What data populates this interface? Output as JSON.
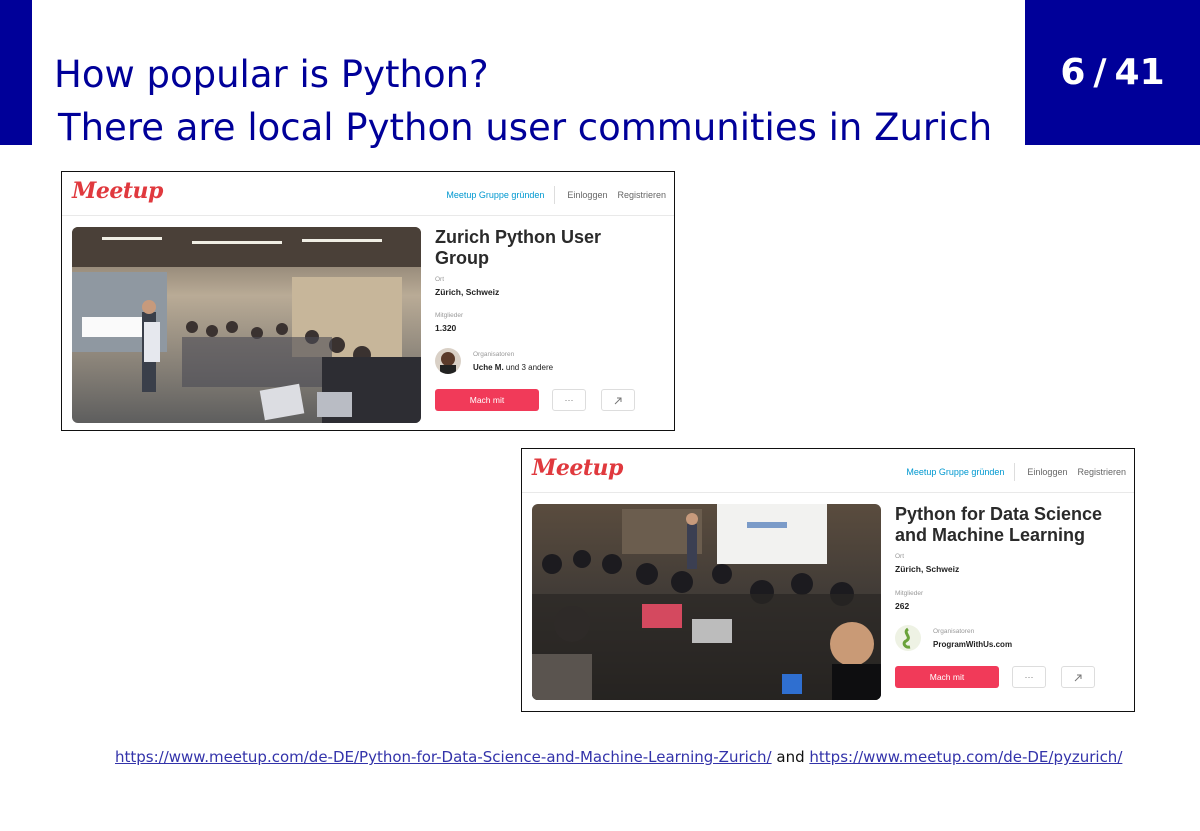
{
  "slide": {
    "title_line1": "How popular is Python?",
    "title_line2": "There are local Python user communities in Zurich",
    "page_current": "6",
    "page_sep": "/",
    "page_total": "41",
    "accent_color": "#000099"
  },
  "cards": [
    {
      "logo": "Meetup",
      "nav_create": "Meetup Gruppe gründen",
      "nav_login": "Einloggen",
      "nav_register": "Registrieren",
      "group_name": "Zurich Python User Group",
      "location_label": "Ort",
      "location": "Zürich, Schweiz",
      "members_label": "Mitglieder",
      "members": "1.320",
      "organizers_label": "Organisatoren",
      "organizer_name": "Uche M.",
      "organizer_suffix": "und 3 andere",
      "join_button": "Mach mit",
      "more_button": "···",
      "share_icon": "share-icon"
    },
    {
      "logo": "Meetup",
      "nav_create": "Meetup Gruppe gründen",
      "nav_login": "Einloggen",
      "nav_register": "Registrieren",
      "group_name": "Python for Data Science and Machine Learning",
      "location_label": "Ort",
      "location": "Zürich, Schweiz",
      "members_label": "Mitglieder",
      "members": "262",
      "organizers_label": "Organisatoren",
      "organizer_name": "ProgramWithUs.com",
      "join_button": "Mach mit",
      "more_button": "···",
      "share_icon": "share-icon"
    }
  ],
  "footer": {
    "link1": "https://www.meetup.com/de-DE/Python-for-Data-Science-and-Machine-Learning-Zurich/",
    "conjunction": "and",
    "link2": "https://www.meetup.com/de-DE/pyzurich/"
  },
  "colors": {
    "meetup_red": "#e0393e",
    "join_button": "#f13a59",
    "nav_link": "#0098d0"
  }
}
